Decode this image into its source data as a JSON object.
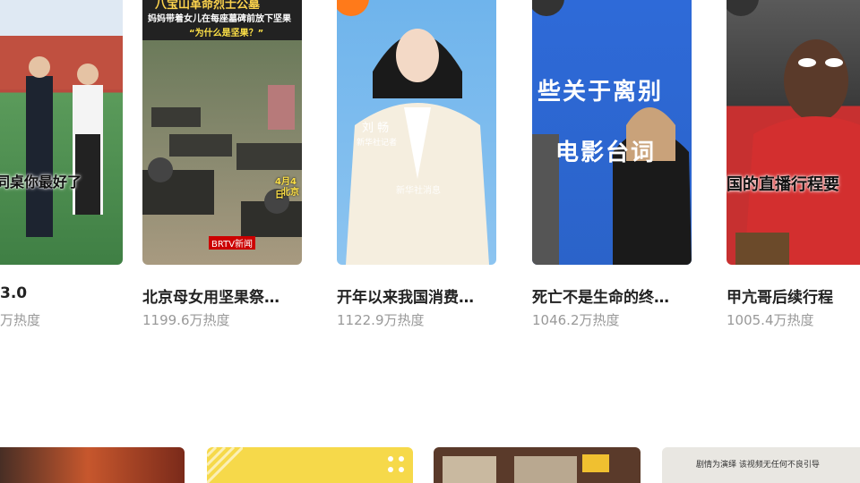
{
  "cards": [
    {
      "title": "3.0",
      "heat": "万热度",
      "overlay": "同桌你最好了"
    },
    {
      "title": "北京母女用坚果祭…",
      "heat": "1199.6万热度",
      "banner_top": "八宝山革命烈士公墓",
      "banner_sub": "妈妈带着女儿在每座墓碑前放下坚果",
      "quote": "“为什么是坚果？”",
      "date": "4月4日",
      "place": "北京",
      "logo": "BRTV新闻"
    },
    {
      "title": "开年以来我国消费…",
      "heat": "1122.9万热度",
      "name": "刘 畅",
      "role": "新华社记者",
      "watermark": "新华社消息"
    },
    {
      "title": "死亡不是生命的终…",
      "heat": "1046.2万热度",
      "line1": "些关于离别",
      "line2": "电影台词"
    },
    {
      "title": "甲亢哥后续行程",
      "heat": "1005.4万热度",
      "overlay": "国的直播行程要"
    }
  ],
  "bottom": {
    "caption4": "剧情为演绎 该视频无任何不良引导"
  },
  "colors": {
    "rank_orange": "#ff7a1a",
    "rank_dark": "#333333"
  }
}
